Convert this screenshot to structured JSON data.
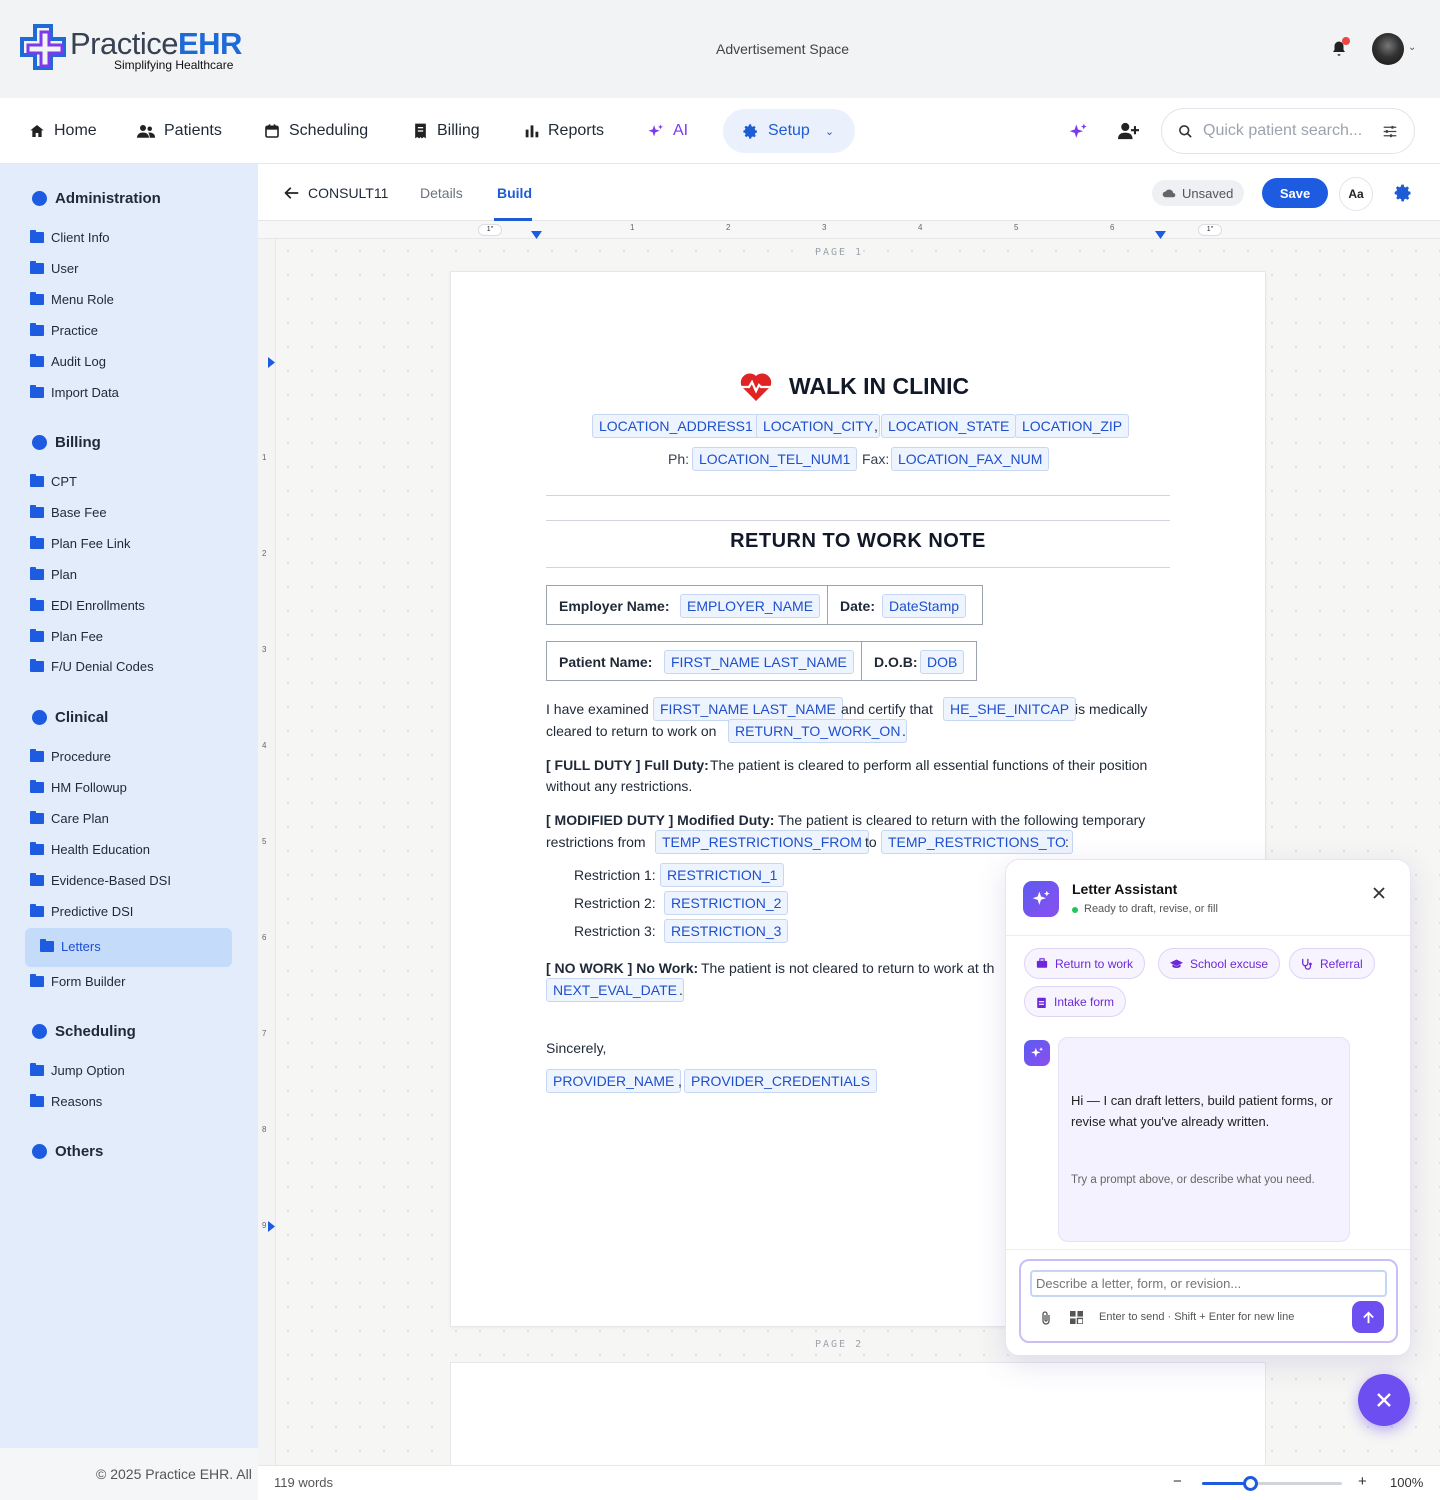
{
  "brand": {
    "name_a": "Practice",
    "name_b": "EHR",
    "tagline": "Simplifying Healthcare"
  },
  "header": {
    "ad_text": "Advertisement Space"
  },
  "nav": {
    "items": [
      {
        "label": "Home",
        "icon": "home-icon"
      },
      {
        "label": "Patients",
        "icon": "users-icon"
      },
      {
        "label": "Scheduling",
        "icon": "calendar-icon"
      },
      {
        "label": "Billing",
        "icon": "receipt-icon"
      },
      {
        "label": "Reports",
        "icon": "bar-chart-icon"
      },
      {
        "label": "AI",
        "icon": "sparkle-icon"
      },
      {
        "label": "Setup",
        "icon": "gear-icon"
      }
    ],
    "search_placeholder": "Quick patient search..."
  },
  "sidebar": {
    "sections": [
      {
        "title": "Administration",
        "items": [
          "Client Info",
          "User",
          "Menu Role",
          "Practice",
          "Audit Log",
          "Import Data"
        ]
      },
      {
        "title": "Billing",
        "items": [
          "CPT",
          "Base Fee",
          "Plan Fee Link",
          "Plan",
          "EDI Enrollments",
          "Plan Fee",
          "F/U Denial Codes"
        ]
      },
      {
        "title": "Clinical",
        "items": [
          "Procedure",
          "HM Followup",
          "Care Plan",
          "Health Education",
          "Evidence-Based DSI",
          "Predictive DSI",
          "Letters",
          "Form Builder"
        ]
      },
      {
        "title": "Scheduling",
        "items": [
          "Jump Option",
          "Reasons"
        ]
      },
      {
        "title": "Others",
        "items": []
      }
    ],
    "active_item": "Letters",
    "copyright": "© 2025 Practice EHR. All"
  },
  "editor": {
    "doc_name": "CONSULT11",
    "tabs": [
      "Details",
      "Build"
    ],
    "active_tab": "Build",
    "status": "Unsaved",
    "save_label": "Save",
    "font_label": "Aa",
    "ruler_h": [
      "1\"",
      "1",
      "2",
      "3",
      "4",
      "5",
      "6",
      "1\""
    ],
    "ruler_v": [
      "1",
      "2",
      "3",
      "4",
      "5",
      "6",
      "7",
      "8",
      "9"
    ],
    "page1_label": "PAGE 1",
    "page2_label": "PAGE 2",
    "word_count": "119 words",
    "zoom": "100%",
    "zoom_minus": "−",
    "zoom_plus": "+"
  },
  "letter": {
    "clinic_name": "WALK IN CLINIC",
    "addr1": "LOCATION_ADDRESS1",
    "city": "LOCATION_CITY",
    "state": "LOCATION_STATE",
    "zip": "LOCATION_ZIP",
    "ph_label": "Ph:",
    "phone": "LOCATION_TEL_NUM1",
    "fax_label": "Fax:",
    "fax": "LOCATION_FAX_NUM",
    "title": "RETURN TO WORK NOTE",
    "employer_label": "Employer Name:",
    "employer": "EMPLOYER_NAME",
    "date_label": "Date:",
    "date": "DateStamp",
    "patient_label": "Patient Name:",
    "patient": "FIRST_NAME LAST_NAME",
    "dob_label": "D.O.B:",
    "dob": "DOB",
    "p1_a": "I have examined",
    "p1_name": "FIRST_NAME LAST_NAME",
    "p1_b": "and certify that",
    "p1_pronoun": "HE_SHE_INITCAP",
    "p1_c": "is medically",
    "p1_d": "cleared to return to work on",
    "p1_date": "RETURN_TO_WORK_ON",
    "full_bold": "[ FULL DUTY ] Full Duty:",
    "full_text": "The patient is cleared to perform all essential functions of their position",
    "full_text2": "without any restrictions.",
    "mod_bold": "[ MODIFIED DUTY ] Modified Duty:",
    "mod_text": "The patient is cleared to return with the following temporary",
    "mod_text2": "restrictions from",
    "mod_from": "TEMP_RESTRICTIONS_FROM",
    "mod_to_word": "to",
    "mod_to": "TEMP_RESTRICTIONS_TO",
    "restrictions": [
      {
        "label": "Restriction 1:",
        "value": "RESTRICTION_1"
      },
      {
        "label": "Restriction 2:",
        "value": "RESTRICTION_2"
      },
      {
        "label": "Restriction 3:",
        "value": "RESTRICTION_3"
      }
    ],
    "nowork_bold": "[ NO WORK ] No Work:",
    "nowork_text": "The patient is not cleared to return to work at th",
    "next_eval": "NEXT_EVAL_DATE",
    "sincerely": "Sincerely,",
    "provider": "PROVIDER_NAME",
    "credentials": "PROVIDER_CREDENTIALS"
  },
  "assistant": {
    "title": "Letter Assistant",
    "status": "Ready to draft, revise, or fill",
    "chips": [
      "Return to work",
      "School excuse",
      "Referral",
      "Intake form"
    ],
    "message": "Hi — I can draft letters, build patient forms, or revise what you've already written.",
    "hint": "Try a prompt above, or describe what you need.",
    "input_placeholder": "Describe a letter, form, or revision...",
    "send_hint": "Enter to send · Shift + Enter for new line"
  },
  "colors": {
    "brand_blue": "#1e6ad6",
    "accent_purple": "#6d4ef0",
    "tag_blue": "#1e4fcc"
  }
}
